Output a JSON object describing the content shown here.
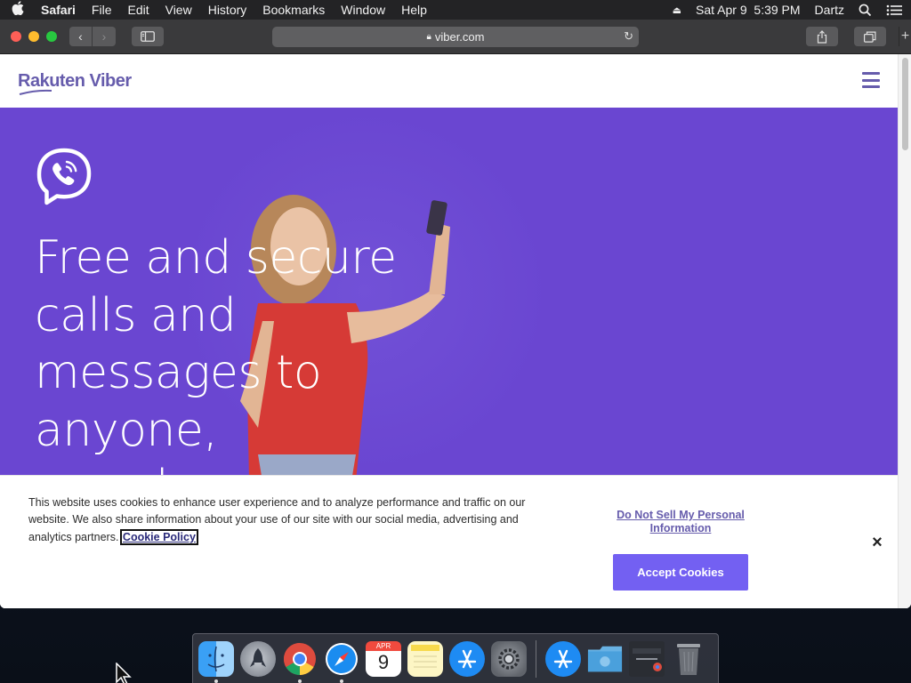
{
  "menubar": {
    "app_name": "Safari",
    "items": [
      "File",
      "Edit",
      "View",
      "History",
      "Bookmarks",
      "Window",
      "Help"
    ],
    "datetime": "Sat Apr 9  5:39 PM",
    "user": "Dartz",
    "icons": [
      "apple-icon",
      "eject-icon",
      "spotlight-search-icon",
      "notification-center-icon"
    ]
  },
  "browser": {
    "url": "viber.com",
    "buttons": [
      "back",
      "forward",
      "sidebar",
      "share",
      "tabs-overview",
      "new-tab"
    ]
  },
  "site": {
    "logo_text": "Rakuten Viber",
    "hero_title": "Free and secure calls and messages to anyone, anywhere",
    "colors": {
      "brand": "#665cac",
      "hero_bg": "#6a46d1",
      "accept_button": "#7360f2"
    }
  },
  "cookie_banner": {
    "text": "This website uses cookies to enhance user experience and to analyze performance and traffic on our website. We also share information about your use of our site with our social media, advertising and analytics partners.",
    "policy_link": "Cookie Policy",
    "do_not_sell": "Do Not Sell My Personal Information",
    "accept_label": "Accept Cookies",
    "close_label": "×"
  },
  "calendar": {
    "month": "APR",
    "day": "9"
  },
  "dock": {
    "apps": [
      "Finder",
      "Launchpad",
      "Google Chrome",
      "Safari",
      "Calendar",
      "Notes",
      "App Store",
      "System Preferences"
    ],
    "others": [
      "Applications",
      "Downloads",
      "Chrome Document",
      "Trash"
    ]
  }
}
